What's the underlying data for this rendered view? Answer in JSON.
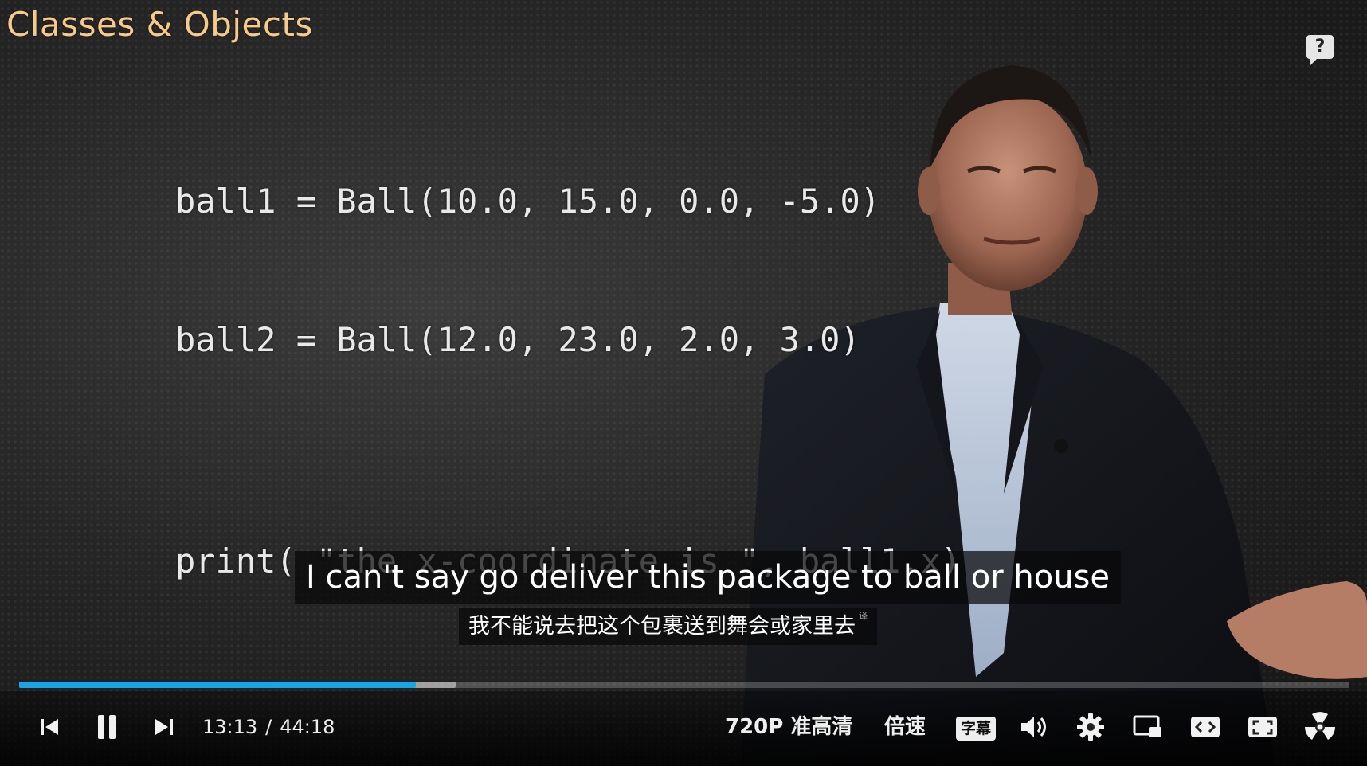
{
  "video": {
    "slide_title": "Classes & Objects",
    "code_lines": [
      "ball1 = Ball(10.0, 15.0, 0.0, -5.0)",
      "ball2 = Ball(12.0, 23.0, 2.0, 3.0)",
      "print( \"the x-coordinate is \", ball1.x)"
    ],
    "help_label": "?"
  },
  "subtitles": {
    "english": "I can't say go deliver this package to ball or house",
    "chinese": "我不能说去把这个包裹送到舞会或家里去",
    "translation_mark": "译"
  },
  "player": {
    "current_time": "13:13",
    "time_separator": "/",
    "duration": "44:18",
    "progress_played_fraction": 0.298,
    "progress_buffered_fraction": 0.328,
    "progress_color": "#1aa4e6",
    "quality_label": "720P 准高清",
    "speed_label": "倍速",
    "subtitle_button_label": "字幕",
    "icons": {
      "previous": "skip-previous-icon",
      "pause": "pause-icon",
      "next": "skip-next-icon",
      "volume": "volume-icon",
      "settings": "gear-icon",
      "pip": "picture-in-picture-icon",
      "theater": "theater-mode-icon",
      "fullscreen": "fullscreen-icon",
      "extra": "radiation-icon"
    }
  }
}
